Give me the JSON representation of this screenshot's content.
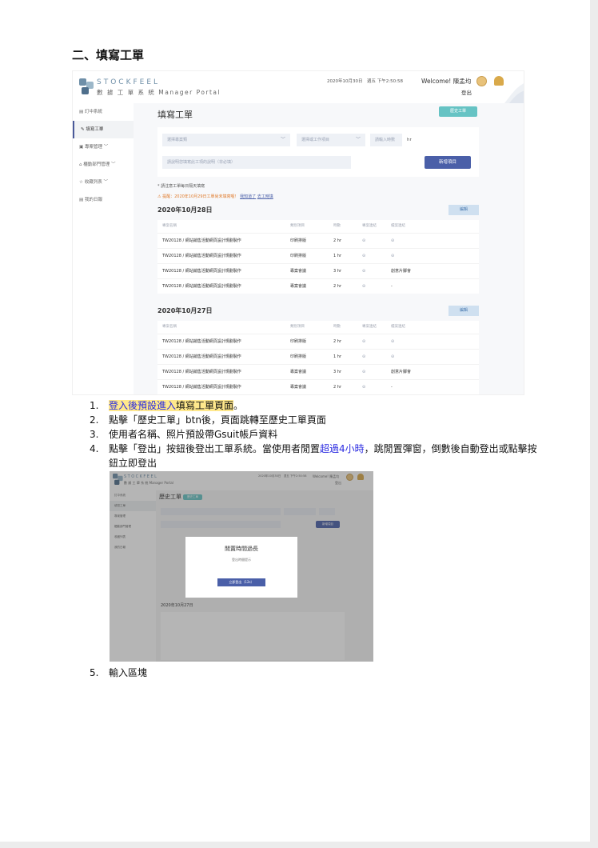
{
  "section_title": "二、填寫工單",
  "screenshot1": {
    "brand": "STOCKFEEL",
    "portal": "數 據 工 單 系 統  Manager Portal",
    "datetime": "2020年10月30日　週五 下午2:50:58",
    "welcome": "Welcome! 陳孟均",
    "logout": "登出",
    "sidebar": [
      "訂中系統",
      "填寫工單",
      "專案管理",
      "櫃動部門管理",
      "收藏列表",
      "我的日報"
    ],
    "sidebar_chevrons": [
      "",
      "",
      "﹀",
      "﹀",
      "﹀",
      ""
    ],
    "page_title": "填寫工單",
    "history_btn": "歷史工單",
    "select1": "選擇專案類",
    "select2": "選擇或工作項目",
    "hours_input": "請輸入時數",
    "hours_unit": "hr",
    "desc_input": "請說明您填寫此工項的說明（非必填）",
    "add_btn": "新增項目",
    "note1": "* 請注意工單每日隔天填寫",
    "note2_prefix": "提醒：2020年10月29日工單尚未填寫喔！",
    "note2_link1": "我知道了",
    "note2_link2": "去工時填",
    "edit_label": "編輯",
    "headers": [
      "專案名稱",
      "類別項目",
      "時數",
      "專案連結",
      "檔案連結"
    ],
    "days": [
      {
        "date": "2020年10月28日",
        "rows": [
          [
            "TW20128 / 網站銷售活動網頁設計規劃製作",
            "印刷排版",
            "2 hr",
            "⊝",
            "⊝"
          ],
          [
            "TW20128 / 網站銷售活動網頁設計規劃製作",
            "印刷排版",
            "1 hr",
            "⊝",
            "⊝"
          ],
          [
            "TW20128 / 網站銷售活動網頁設計規劃製作",
            "專案會議",
            "3 hr",
            "⊝",
            "創意片腳會"
          ],
          [
            "TW20128 / 網站銷售活動網頁設計規劃製作",
            "專案會議",
            "2 hr",
            "⊝",
            "-"
          ]
        ]
      },
      {
        "date": "2020年10月27日",
        "rows": [
          [
            "TW20128 / 網站銷售活動網頁設計規劃製作",
            "印刷排版",
            "2 hr",
            "⊝",
            "⊝"
          ],
          [
            "TW20128 / 網站銷售活動網頁設計規劃製作",
            "印刷排版",
            "1 hr",
            "⊝",
            "⊝"
          ],
          [
            "TW20128 / 網站銷售活動網頁設計規劃製作",
            "專案會議",
            "3 hr",
            "⊝",
            "創意片腳會"
          ],
          [
            "TW20128 / 網站銷售活動網頁設計規劃製作",
            "專案會議",
            "2 hr",
            "⊝",
            "-"
          ]
        ]
      }
    ]
  },
  "list": {
    "item1": {
      "num": "1.",
      "blue": "登入後預設進入",
      "plain": "填寫工單頁面",
      "end": "。"
    },
    "item2": {
      "num": "2.",
      "text": "點擊「歷史工單」btn後，頁面跳轉至歷史工單頁面"
    },
    "item3": {
      "num": "3.",
      "text": "使用者名稱、照片預設帶Gsuit帳戶資料"
    },
    "item4": {
      "num": "4.",
      "before": "點擊「登出」按鈕後登出工單系統。當使用者閒置",
      "blue": "超過4小時",
      "after": "，跳閒置彈窗，倒數後自動登出或點擊按鈕立即登出"
    },
    "item5": {
      "num": "5.",
      "text": "輸入區塊"
    }
  },
  "screenshot2": {
    "modal_title": "閒置時間過長",
    "modal_sub": "登出時間提示",
    "modal_btn": "立即登出（12s）",
    "page_title": "歷史工單",
    "day_label": "2020年10月27日"
  }
}
